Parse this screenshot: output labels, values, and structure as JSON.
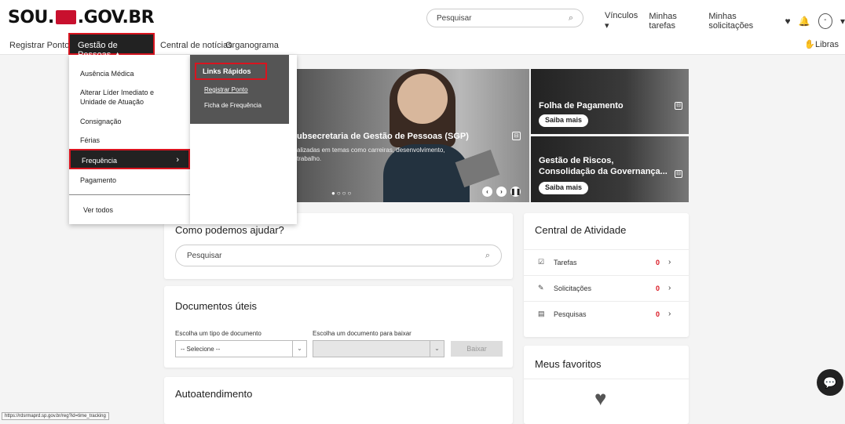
{
  "header": {
    "logo_left": "SOU.",
    "logo_right": ".GOV.BR",
    "search_placeholder": "Pesquisar",
    "links": [
      "Vínculos",
      "Minhas tarefas",
      "Minhas solicitações"
    ],
    "avatar_glyph": "-",
    "chevron_glyph": "▾"
  },
  "nav": {
    "items": [
      "Registrar Ponto",
      "Gestão de Pessoas ▲",
      "Central de notícias",
      "Organograma"
    ],
    "libras": "Libras"
  },
  "dropdown": {
    "items": [
      "Ausência Médica",
      "Alterar Líder Imediato e Unidade de Atuação",
      "Consignação",
      "Férias",
      "Frequência",
      "Pagamento",
      "Ver todos"
    ],
    "active_chevron": "›"
  },
  "subpanel": {
    "title": "Links Rápidos",
    "links": [
      "Registrar Ponto",
      "Ficha de Frequência"
    ]
  },
  "hero": {
    "title": "ubsecretaria de Gestão de Pessoas (SGP)",
    "subtitle_line1": "alizadas em temas como carreiras, desenvolvimento,",
    "subtitle_line2": "trabalho.",
    "dots": "●○○○"
  },
  "side_cards": [
    {
      "title": "Folha de Pagamento",
      "button": "Saiba mais"
    },
    {
      "title": "Gestão de Riscos, Consolidação da Governança...",
      "button": "Saiba mais"
    }
  ],
  "help": {
    "title": "Como podemos ajudar?",
    "search_placeholder": "Pesquisar"
  },
  "documents": {
    "title": "Documentos úteis",
    "type_label": "Escolha um tipo de documento",
    "type_value": "-- Selecione --",
    "doc_label": "Escolha um documento para baixar",
    "doc_value": "",
    "download_label": "Baixar"
  },
  "autoatendimento": {
    "title": "Autoatendimento"
  },
  "activity": {
    "title": "Central de Atividade",
    "rows": [
      {
        "label": "Tarefas",
        "count": "0"
      },
      {
        "label": "Solicitações",
        "count": "0"
      },
      {
        "label": "Pesquisas",
        "count": "0"
      }
    ]
  },
  "favorites": {
    "title": "Meus favoritos"
  },
  "status_bar": "https://rdsrmaprd.sp.gov.br/reg?id=time_tracking",
  "colors": {
    "accent": "#d9141f",
    "dark": "#222222"
  }
}
